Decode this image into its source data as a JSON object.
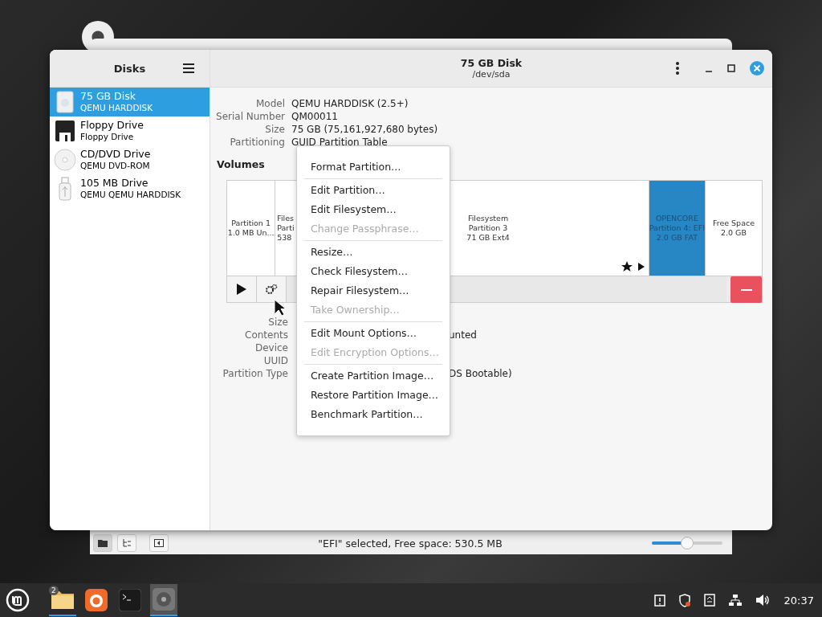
{
  "back_window": {
    "status_bar": {
      "buttons": [
        {
          "selected": true
        },
        {
          "selected": false
        },
        {
          "selected": false
        }
      ],
      "text": "\"EFI\" selected, Free space: 530.5 MB",
      "zoom": {
        "level": 0.5
      }
    }
  },
  "sidebar": {
    "title": "Disks",
    "items": [
      {
        "kind": "hdd",
        "name": "75 GB Disk",
        "subtitle": "QEMU HARDDISK",
        "selected": true
      },
      {
        "kind": "floppy",
        "name": "Floppy Drive",
        "subtitle": "Floppy Drive",
        "selected": false
      },
      {
        "kind": "cd",
        "name": "CD/DVD Drive",
        "subtitle": "QEMU DVD-ROM",
        "selected": false
      },
      {
        "kind": "usb",
        "name": "105 MB Drive",
        "subtitle": "QEMU QEMU HARDDISK",
        "selected": false
      }
    ]
  },
  "header": {
    "title": "75 GB Disk",
    "subtitle": "/dev/sda"
  },
  "drive_info": [
    {
      "label": "Model",
      "value": "QEMU HARDDISK (2.5+)"
    },
    {
      "label": "Serial Number",
      "value": "QM00011"
    },
    {
      "label": "Size",
      "value": "75 GB (75,161,927,680 bytes)"
    },
    {
      "label": "Partitioning",
      "value": "GUID Partition Table"
    }
  ],
  "volumes": {
    "title": "Volumes",
    "segments": [
      {
        "lines": [
          "Partition 1",
          "1.0 MB Un..."
        ],
        "selected": false,
        "mounted": false
      },
      {
        "lines": [
          "Files",
          "Parti",
          "538"
        ],
        "selected": false,
        "mounted": false
      },
      {
        "lines": [
          "Filesystem",
          "Partition 3",
          "71 GB Ext4"
        ],
        "selected": false,
        "mounted": true
      },
      {
        "lines": [
          "OPENCORE",
          "Partition 4: EFI",
          "2.0 GB FAT"
        ],
        "selected": true,
        "mounted": false
      },
      {
        "lines": [
          "Free Space",
          "2.0 GB"
        ],
        "selected": false,
        "mounted": false
      }
    ]
  },
  "volume_info": [
    {
      "label": "Size"
    },
    {
      "label": "Contents",
      "value": "unted"
    },
    {
      "label": "Device"
    },
    {
      "label": "UUID"
    },
    {
      "label": "Partition Type",
      "value": "DS Bootable)"
    }
  ],
  "menu": {
    "sections": [
      [
        {
          "label": "Format Partition…",
          "disabled": false
        }
      ],
      [
        {
          "label": "Edit Partition…",
          "disabled": false
        },
        {
          "label": "Edit Filesystem…",
          "disabled": false
        },
        {
          "label": "Change Passphrase…",
          "disabled": true
        }
      ],
      [
        {
          "label": "Resize…",
          "disabled": false
        },
        {
          "label": "Check Filesystem…",
          "disabled": false
        },
        {
          "label": "Repair Filesystem…",
          "disabled": false
        },
        {
          "label": "Take Ownership…",
          "disabled": true
        }
      ],
      [
        {
          "label": "Edit Mount Options…",
          "disabled": false
        },
        {
          "label": "Edit Encryption Options…",
          "disabled": true
        }
      ],
      [
        {
          "label": "Create Partition Image…",
          "disabled": false
        },
        {
          "label": "Restore Partition Image…",
          "disabled": false
        },
        {
          "label": "Benchmark Partition…",
          "disabled": false
        }
      ]
    ]
  },
  "taskbar": {
    "apps": [
      {
        "kind": "folder",
        "badge": "2",
        "selected": false,
        "running": true
      },
      {
        "kind": "browser",
        "selected": false,
        "running": false
      },
      {
        "kind": "terminal",
        "selected": false,
        "running": false
      },
      {
        "kind": "disks",
        "selected": true,
        "running": true
      }
    ],
    "clock": "20:37"
  }
}
